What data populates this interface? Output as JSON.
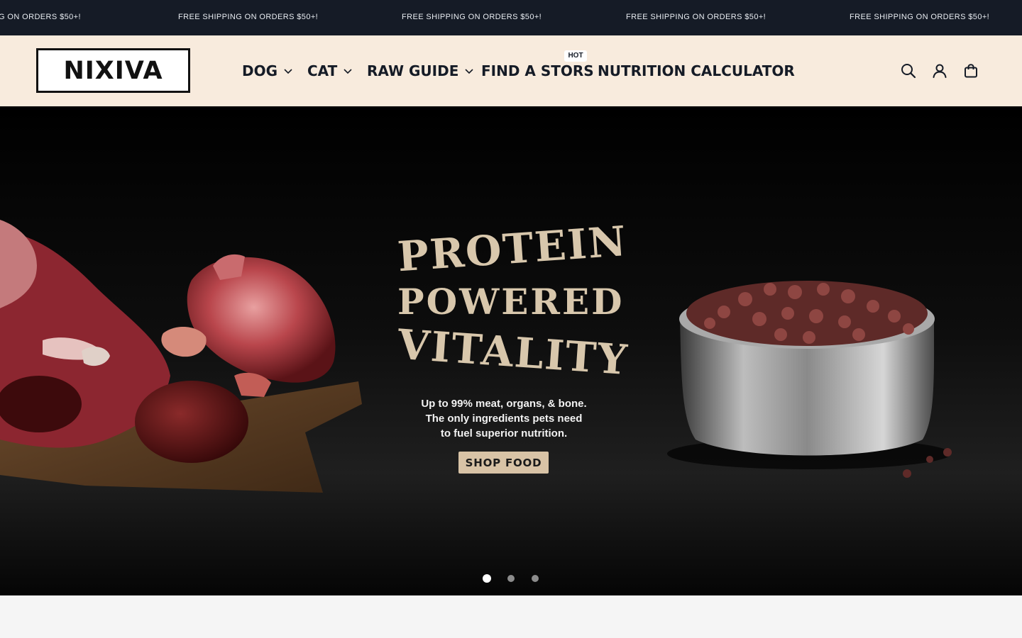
{
  "announcement": {
    "text": "FREE SHIPPING ON ORDERS $50+!",
    "partial_text": "G ON ORDERS $50+!"
  },
  "header": {
    "logo": "NIXIVA",
    "nav": [
      {
        "label": "DOG",
        "has_dropdown": true
      },
      {
        "label": "CAT",
        "has_dropdown": true
      },
      {
        "label": "RAW GUIDE",
        "has_dropdown": true
      },
      {
        "label": "FIND A STORS",
        "has_dropdown": false,
        "badge": "HOT"
      },
      {
        "label": "NUTRITION CALCULATOR",
        "has_dropdown": false
      }
    ],
    "icons": [
      "search-icon",
      "account-icon",
      "cart-icon"
    ]
  },
  "hero": {
    "headline": {
      "line1": "PROTEIN",
      "line2": "POWERED",
      "line3": "VITALITY"
    },
    "subtext": {
      "line1": "Up to 99% meat, organs, & bone.",
      "line2": "The only ingredients pets need",
      "line3": "to fuel superior nutrition."
    },
    "cta": "SHOP FOOD",
    "slides": {
      "count": 3,
      "active": 1
    }
  },
  "colors": {
    "announcement_bg": "#151b26",
    "header_bg": "#f8ebdd",
    "hero_bg": "#000000",
    "headline": "#d8c7ac",
    "cta_bg": "#d8c3a6",
    "page_bg": "#f5f5f5"
  }
}
